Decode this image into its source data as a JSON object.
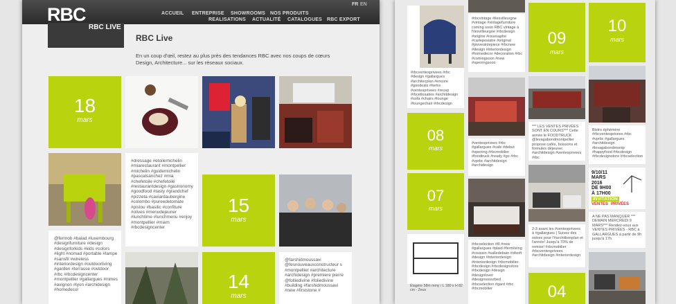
{
  "header": {
    "logo": "RBC",
    "logo_sub": "RBC LIVE",
    "nav": [
      "ACCUEIL",
      "ENTREPRISE",
      "SHOWROOMS",
      "NOS PRODUITS",
      "REALISATIONS",
      "ACTUALITÉ",
      "CATALOGUES",
      "RBC EXPORT"
    ],
    "lang": [
      "FR",
      "EN"
    ]
  },
  "page": {
    "title": "RBC Live",
    "intro": "En un coup d'œil, restez au plus près des tendances RBC avec nos coups de cœurs Design, Architecture... sur les réseaux sociaux."
  },
  "left": {
    "dates": [
      {
        "day": "18",
        "month": "mars"
      },
      {
        "day": "15",
        "month": "mars"
      },
      {
        "day": "14",
        "month": "mars"
      }
    ],
    "captions": [
      "#dressage #etoilemichelin #miarestaurant #montpellier #michelin #guidemichelin #pascalsanchez #mia #chefetoile #chefetoilé #restaurantdesign #gastronomy #goodfood #tasty #grandchef #pizzeta #caviardaubergine #colombo #pureedetomate #pistou #basilic #confiture #olives #menudejeuner #lunchtime #lunchmenu #enjoy #montpellier #miam #rbcdesigncenter",
      "@fermob #balad #luxembourg #designfurniture #design #designforkids #kids #colors #light #nomad #portable #lampe #sansfil #wireless #interiordesign #outdoorliving #garden #terrasse #outdoor #rbc #rbcdesigncenter #montpellier #gallargues #nimes #avignon #lyon #archidesign #homedecor",
      "@farshidmoussavi @fesnouveauxconstructeur s #montpellier #architecture #archidesign #premiere pierre @folliedivine #foliedivine #building #farshidmoussavi #new #firststone #"
    ]
  },
  "right": {
    "dates": [
      {
        "day": "09",
        "month": "mars"
      },
      {
        "day": "10",
        "month": "mars"
      },
      {
        "day": "08",
        "month": "mars"
      },
      {
        "day": "07",
        "month": "mars"
      },
      {
        "day": "04",
        "month": ""
      }
    ],
    "captions": [
      "#rbcvintage #ilesvilleurgne #vintage #vintagefurniture coming soon RBC vintage à l'ilesvilleurgne #rbcdesign #origine #rouesaphe #carleposiatre #original #pievesinlepiece #rbcnew #design #interiordesign #homedecor #decoration #rbc #comingsoon #new #openingsoon",
      "#rbcventesprivees #rbc #design #gallargues #architecplan #encore #goodeals #items #ventesprivees #reuvp #rbcetlosatios #architdesign #sofa #chairs #lounge #loungechair #rbcdesign",
      "#ventesprivees #rbc #gallargues #cafe #debut #opening #rbcmobilier #foodtruck #ready #go #rbc #vprbc #architdesign #archidesign",
      "*** LES VENTES PRIVÉES SONT EN COURS*** Cette année le FOODTRUCK @levagabondmontpellier propose cafés, boissons et formules déjeuner. #architdesign #ventesprivees #rbc",
      "Bistro éphémère #rbcventesprivees #rbc #vprbc #gallargues #architdesign #levagabondmontp #happyfood #rbcdesign #rbcdesignstore #rbcselection",
      "#rbcselection #ill #new #gallargues #plaid #fermliving #coussin #salledebain #ofsoft #design #interiordesign #interiordesign #rbcmobilier #rbcdesign #rbcdesignstore #rbcdesign #design #designlover #designsouvrbed #rbcselection #gard #rbc #rbcmobilier",
      "2-3 avant les #ventesprivees à #gallargues | Suivez des notres pour l'#architbonplan et l'année! Jusqu'à 70% de remise! #rbcmobilier #rbcventesprivees #architdesign #interiordesign",
      "A NE PAS MANQUER *** DEMAIN MERCREDI 9 MARS*** Rendez-vous aux VENTES PRIVÉES - RBC à GALLARGUES à partir de 9h jusqu'à 17h.",
      "Étagère 58m mmy / L 180 x H 82 cm - Zeus"
    ],
    "poster": {
      "line1": "9/10/11",
      "line2": "MARS",
      "line3": "2016",
      "line4": "DE 9H00",
      "line5": "À 17H00",
      "line6": "INVITATION",
      "line7": "VENTES",
      "line8": "PRIVÉES"
    }
  },
  "colors": {
    "accent": "#b9d30f",
    "header": "#333333",
    "panel": "#eeeeee"
  }
}
